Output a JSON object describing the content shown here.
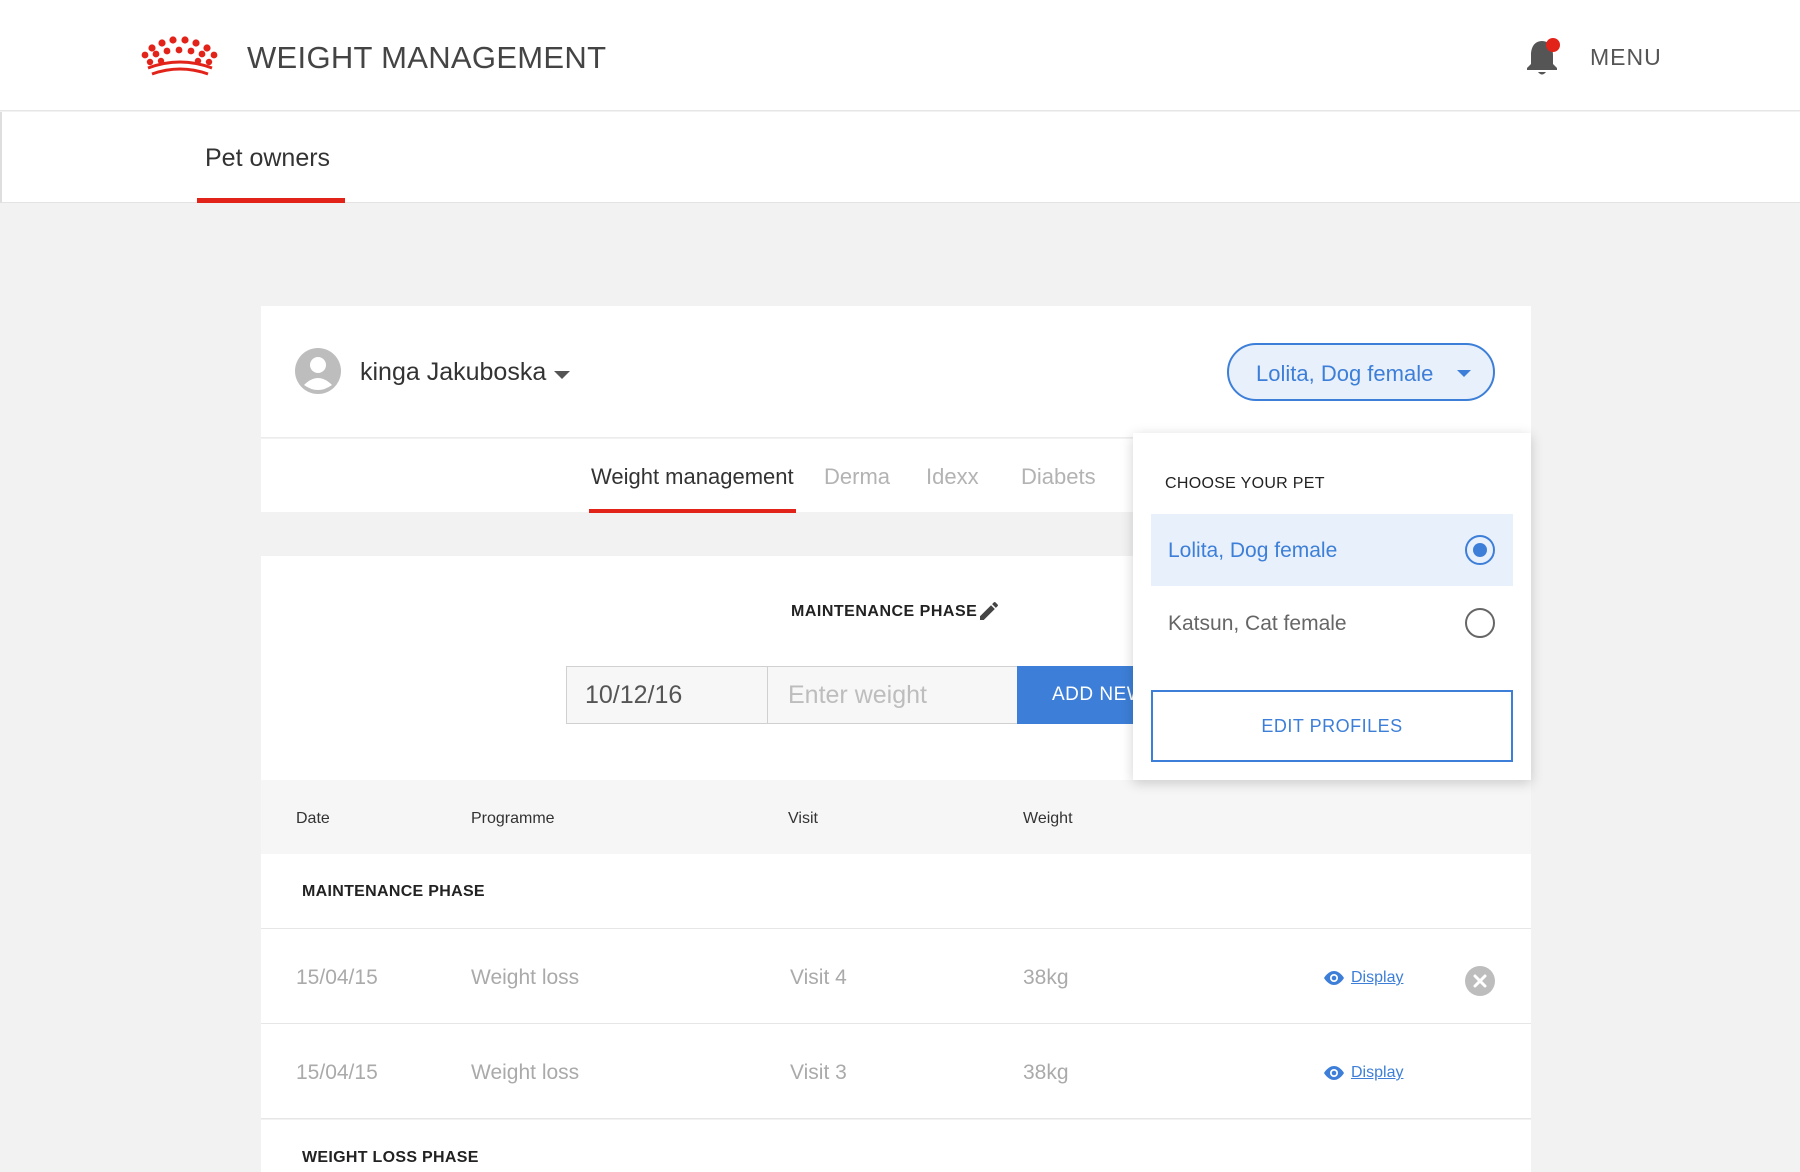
{
  "header": {
    "app_title": "WEIGHT MANAGEMENT",
    "menu_label": "MENU",
    "logo_icon": "crown-logo-icon",
    "notification_icon": "bell-icon",
    "brand_color": "#e2231a"
  },
  "subnav": {
    "active_tab": "Pet owners"
  },
  "owner": {
    "name": "kinga Jakuboska",
    "selected_pet": "Lolita, Dog female"
  },
  "tabs": [
    {
      "label": "Weight management",
      "active": true
    },
    {
      "label": "Derma",
      "active": false
    },
    {
      "label": "Idexx",
      "active": false
    },
    {
      "label": "Diabets",
      "active": false
    }
  ],
  "phase": {
    "title": "MAINTENANCE PHASE",
    "date_value": "10/12/16",
    "weight_placeholder": "Enter weight",
    "add_button": "ADD NEW"
  },
  "table": {
    "columns": [
      "Date",
      "Programme",
      "Visit",
      "Weight"
    ],
    "groups": [
      {
        "title": "MAINTENANCE PHASE",
        "rows": [
          {
            "date": "15/04/15",
            "programme": "Weight loss",
            "visit": "Visit 4",
            "weight": "38kg",
            "action": "Display",
            "removable": true
          },
          {
            "date": "15/04/15",
            "programme": "Weight loss",
            "visit": "Visit 3",
            "weight": "38kg",
            "action": "Display",
            "removable": false
          }
        ]
      },
      {
        "title": "WEIGHT LOSS PHASE",
        "rows": []
      }
    ]
  },
  "pet_dropdown": {
    "title": "CHOOSE YOUR PET",
    "options": [
      {
        "label": "Lolita, Dog female",
        "selected": true
      },
      {
        "label": "Katsun, Cat female",
        "selected": false
      }
    ],
    "edit_button": "EDIT PROFILES"
  },
  "colors": {
    "accent": "#3d7fd8",
    "accent_light": "#e8f0fb",
    "brand_red": "#e2231a"
  }
}
